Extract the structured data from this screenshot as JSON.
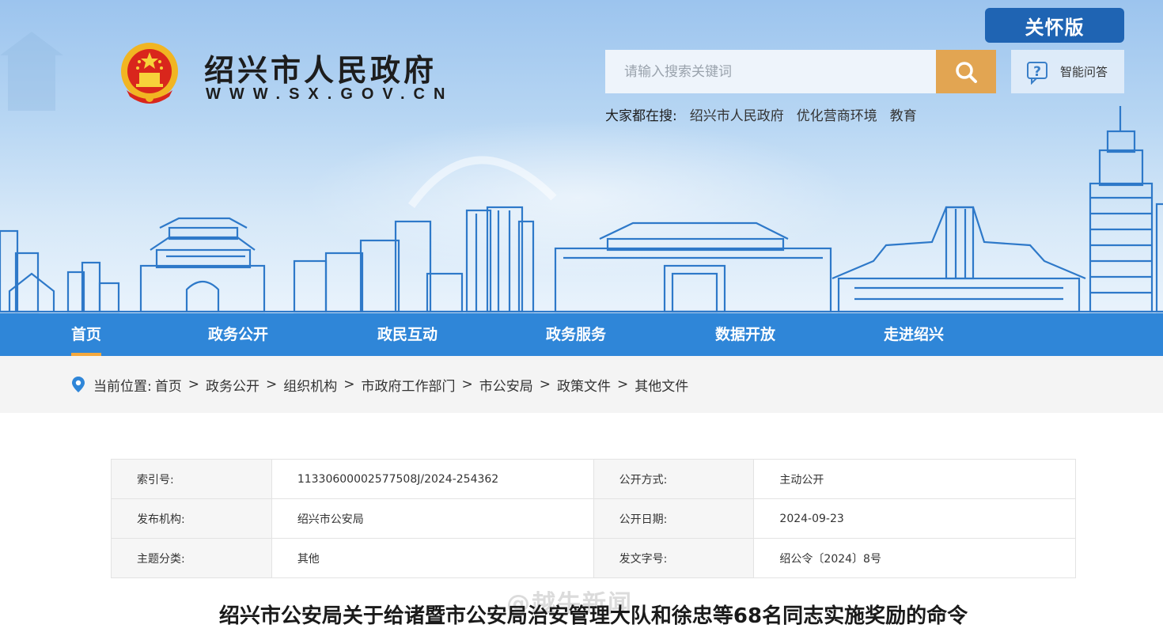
{
  "header": {
    "site_title": "绍兴市人民政府",
    "site_url": "WWW.SX.GOV.CN",
    "care_version": "关怀版",
    "search_placeholder": "请输入搜索关键词",
    "smart_qa": "智能问答",
    "hot_label": "大家都在搜:",
    "hot_items": [
      "绍兴市人民政府",
      "优化营商环境",
      "教育"
    ]
  },
  "nav": {
    "items": [
      "首页",
      "政务公开",
      "政民互动",
      "政务服务",
      "数据开放",
      "走进绍兴"
    ],
    "active": "首页"
  },
  "breadcrumb": {
    "label": "当前位置:",
    "items": [
      "首页",
      "政务公开",
      "组织机构",
      "市政府工作部门",
      "市公安局",
      "政策文件",
      "其他文件"
    ],
    "separator": ">"
  },
  "meta": {
    "rows": [
      {
        "k1": "索引号:",
        "v1": "11330600002577508J/2024-254362",
        "k2": "公开方式:",
        "v2": "主动公开"
      },
      {
        "k1": "发布机构:",
        "v1": "绍兴市公安局",
        "k2": "公开日期:",
        "v2": "2024-09-23"
      },
      {
        "k1": "主题分类:",
        "v1": "其他",
        "k2": "发文字号:",
        "v2": "绍公令〔2024〕8号"
      }
    ]
  },
  "article": {
    "title": "绍兴市公安局关于给诸暨市公安局治安管理大队和徐忠等68名同志实施奖励的命令"
  },
  "watermark": "@越牛新闻",
  "colors": {
    "nav_bg": "#2f86d8",
    "nav_active_underline": "#f4a83d",
    "care_btn": "#1f64b3",
    "search_btn": "#e2a552"
  },
  "icons": {
    "search": "search-icon",
    "qa": "question-chat-icon",
    "location": "location-pin-icon",
    "emblem": "national-emblem-icon"
  }
}
